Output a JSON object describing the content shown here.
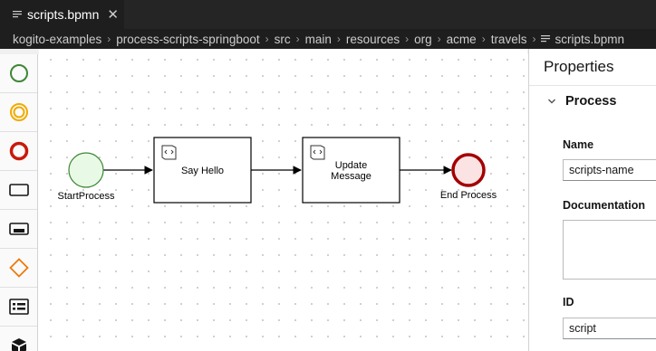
{
  "tab": {
    "title": "scripts.bpmn",
    "close_glyph": "✕",
    "icon": "file-lines-icon"
  },
  "breadcrumb": {
    "segments": [
      "kogito-examples",
      "process-scripts-springboot",
      "src",
      "main",
      "resources",
      "org",
      "acme",
      "travels"
    ],
    "file": "scripts.bpmn",
    "separator": "›"
  },
  "palette": {
    "items": [
      {
        "name": "start-event-icon",
        "color": "#3e8635"
      },
      {
        "name": "intermediate-event-icon",
        "color": "#f0ab00"
      },
      {
        "name": "end-event-icon",
        "color": "#c9190b"
      },
      {
        "name": "task-icon",
        "color": "#151515"
      },
      {
        "name": "subprocess-icon",
        "color": "#151515"
      },
      {
        "name": "gateway-icon",
        "color": "#ec7a08"
      },
      {
        "name": "data-object-icon",
        "color": "#151515"
      },
      {
        "name": "package-icon",
        "color": "#151515"
      }
    ]
  },
  "diagram": {
    "start_event": {
      "label": "StartProcess"
    },
    "task1": {
      "label": "Say Hello",
      "icon": "script-icon"
    },
    "task2": {
      "label_line1": "Update",
      "label_line2": "Message",
      "icon": "script-icon"
    },
    "end_event": {
      "label": "End Process"
    },
    "colors": {
      "start_fill": "#e8fae6",
      "start_stroke": "#3e8635",
      "end_fill": "#fce3e3",
      "end_stroke": "#a30000"
    }
  },
  "properties": {
    "title": "Properties",
    "section": "Process",
    "name_label": "Name",
    "name_value": "scripts-name",
    "documentation_label": "Documentation",
    "documentation_value": "",
    "id_label": "ID",
    "id_value": "script"
  }
}
